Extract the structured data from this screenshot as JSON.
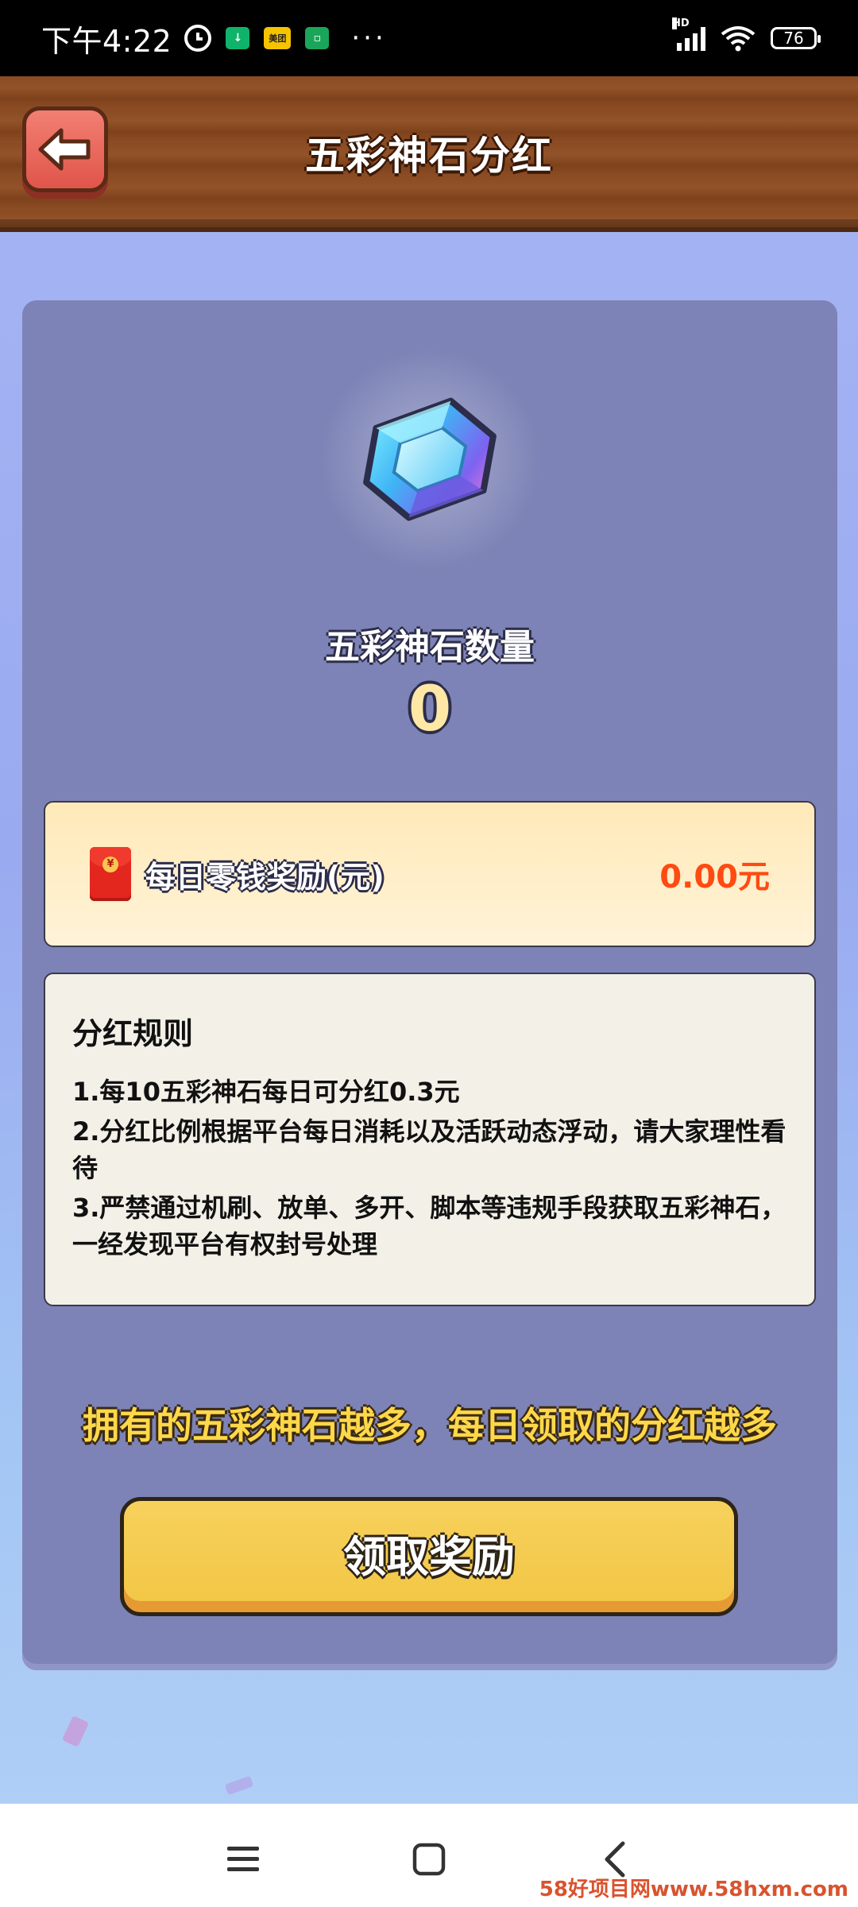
{
  "status_bar": {
    "time": "下午4:22",
    "app_icon_meituan": "美团",
    "more": "···",
    "network": "HD",
    "battery": "76"
  },
  "header": {
    "title": "五彩神石分红"
  },
  "gem": {
    "label": "五彩神石数量",
    "count": "0"
  },
  "reward": {
    "label": "每日零钱奖励(元)",
    "value": "0.00元"
  },
  "rules": {
    "title": "分红规则",
    "items": [
      "1.每10五彩神石每日可分红0.3元",
      "2.分红比例根据平台每日消耗以及活跃动态浮动，请大家理性看待",
      "3.严禁通过机刷、放单、多开、脚本等违规手段获取五彩神石，一经发现平台有权封号处理"
    ]
  },
  "slogan": "拥有的五彩神石越多，每日领取的分红越多",
  "claim_button": "领取奖励",
  "watermark": "58好项目网www.58hxm.com",
  "colors": {
    "header_wood": "#8a4a22",
    "panel": "#7d83b6",
    "reward_bg": "#ffe9b8",
    "reward_value": "#ff4a12",
    "claim_button": "#f2c644",
    "back_button": "#e0554a"
  },
  "icons": {
    "back": "back-arrow-icon",
    "gem": "gem-icon",
    "red_packet": "red-packet-icon",
    "nav_menu": "menu-icon",
    "nav_home": "home-square-icon",
    "nav_back": "chevron-left-icon"
  }
}
